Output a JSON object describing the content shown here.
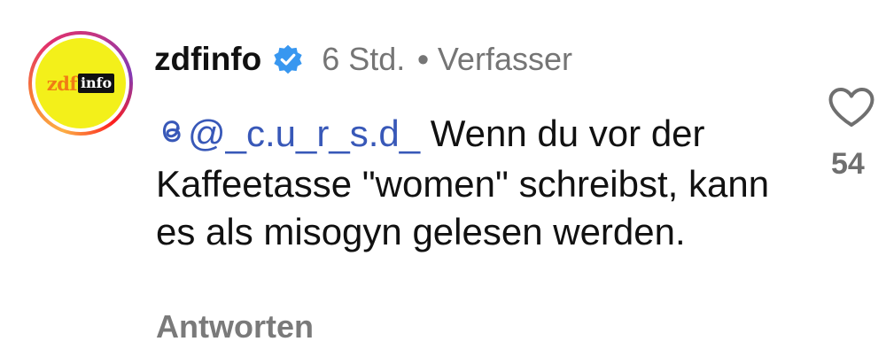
{
  "avatar": {
    "logo_left": "zdf",
    "logo_right": "info",
    "ring_colors": [
      "#fcaf45",
      "#e1306c",
      "#833ab4"
    ],
    "background": "#f3f01a"
  },
  "header": {
    "username": "zdfinfo",
    "verified_icon": "verified-badge-icon",
    "time": "6 Std.",
    "separator": "•",
    "role": "Verfasser"
  },
  "comment": {
    "mention": "@_c.u_r_s.d_",
    "mention_icon": "threads-icon",
    "text": "Wenn du vor der Kaffeetasse \"women\" schreibst, kann es als misogyn gelesen werden."
  },
  "actions": {
    "reply_label": "Antworten",
    "like_icon": "heart-outline-icon",
    "like_count": "54"
  },
  "colors": {
    "mention": "#3858b8",
    "muted": "#757575",
    "verified": "#3897f0"
  }
}
